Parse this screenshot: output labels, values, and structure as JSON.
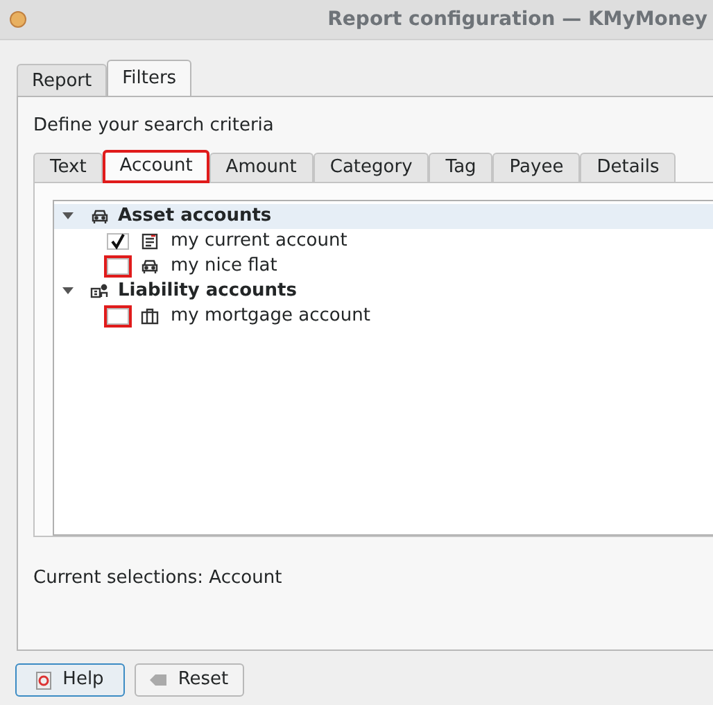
{
  "window": {
    "title": "Report configuration — KMyMoney"
  },
  "tabs": [
    {
      "label": "Report",
      "selected": false
    },
    {
      "label": "Filters",
      "selected": true
    }
  ],
  "heading": "Define your search criteria",
  "filter_tabs": [
    {
      "label": "Text",
      "selected": false,
      "highlighted": false
    },
    {
      "label": "Account",
      "selected": true,
      "highlighted": true
    },
    {
      "label": "Amount",
      "selected": false,
      "highlighted": false
    },
    {
      "label": "Category",
      "selected": false,
      "highlighted": false
    },
    {
      "label": "Tag",
      "selected": false,
      "highlighted": false
    },
    {
      "label": "Payee",
      "selected": false,
      "highlighted": false
    },
    {
      "label": "Details",
      "selected": false,
      "highlighted": false
    }
  ],
  "tree": [
    {
      "label": "Asset accounts",
      "kind": "asset",
      "expanded": true,
      "selected": true,
      "children": [
        {
          "label": "my current account",
          "kind": "checking",
          "checked": true,
          "highlighted": false
        },
        {
          "label": "my nice flat",
          "kind": "asset",
          "checked": false,
          "highlighted": true
        }
      ]
    },
    {
      "label": "Liability accounts",
      "kind": "liability",
      "expanded": true,
      "selected": false,
      "children": [
        {
          "label": "my mortgage account",
          "kind": "loan",
          "checked": false,
          "highlighted": true
        }
      ]
    }
  ],
  "current_selections": "Current selections: Account",
  "buttons": [
    {
      "label": "Help",
      "kind": "help",
      "focused": true
    },
    {
      "label": "Reset",
      "kind": "reset",
      "focused": false
    }
  ]
}
